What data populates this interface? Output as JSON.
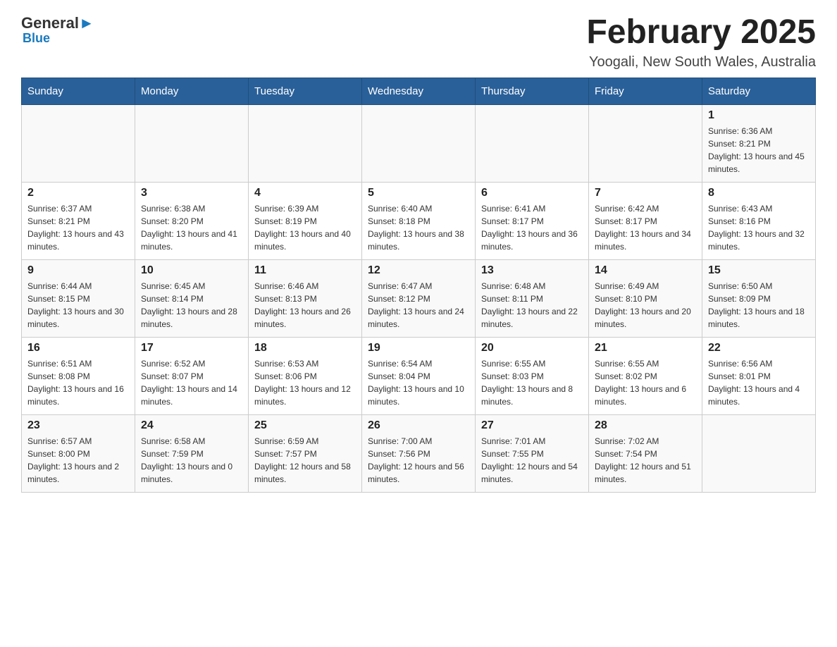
{
  "header": {
    "logo": {
      "general": "General",
      "blue": "Blue",
      "sub": "Blue"
    },
    "title": "February 2025",
    "location": "Yoogali, New South Wales, Australia"
  },
  "weekdays": [
    "Sunday",
    "Monday",
    "Tuesday",
    "Wednesday",
    "Thursday",
    "Friday",
    "Saturday"
  ],
  "weeks": [
    {
      "days": [
        {
          "num": "",
          "info": ""
        },
        {
          "num": "",
          "info": ""
        },
        {
          "num": "",
          "info": ""
        },
        {
          "num": "",
          "info": ""
        },
        {
          "num": "",
          "info": ""
        },
        {
          "num": "",
          "info": ""
        },
        {
          "num": "1",
          "info": "Sunrise: 6:36 AM\nSunset: 8:21 PM\nDaylight: 13 hours and 45 minutes."
        }
      ]
    },
    {
      "days": [
        {
          "num": "2",
          "info": "Sunrise: 6:37 AM\nSunset: 8:21 PM\nDaylight: 13 hours and 43 minutes."
        },
        {
          "num": "3",
          "info": "Sunrise: 6:38 AM\nSunset: 8:20 PM\nDaylight: 13 hours and 41 minutes."
        },
        {
          "num": "4",
          "info": "Sunrise: 6:39 AM\nSunset: 8:19 PM\nDaylight: 13 hours and 40 minutes."
        },
        {
          "num": "5",
          "info": "Sunrise: 6:40 AM\nSunset: 8:18 PM\nDaylight: 13 hours and 38 minutes."
        },
        {
          "num": "6",
          "info": "Sunrise: 6:41 AM\nSunset: 8:17 PM\nDaylight: 13 hours and 36 minutes."
        },
        {
          "num": "7",
          "info": "Sunrise: 6:42 AM\nSunset: 8:17 PM\nDaylight: 13 hours and 34 minutes."
        },
        {
          "num": "8",
          "info": "Sunrise: 6:43 AM\nSunset: 8:16 PM\nDaylight: 13 hours and 32 minutes."
        }
      ]
    },
    {
      "days": [
        {
          "num": "9",
          "info": "Sunrise: 6:44 AM\nSunset: 8:15 PM\nDaylight: 13 hours and 30 minutes."
        },
        {
          "num": "10",
          "info": "Sunrise: 6:45 AM\nSunset: 8:14 PM\nDaylight: 13 hours and 28 minutes."
        },
        {
          "num": "11",
          "info": "Sunrise: 6:46 AM\nSunset: 8:13 PM\nDaylight: 13 hours and 26 minutes."
        },
        {
          "num": "12",
          "info": "Sunrise: 6:47 AM\nSunset: 8:12 PM\nDaylight: 13 hours and 24 minutes."
        },
        {
          "num": "13",
          "info": "Sunrise: 6:48 AM\nSunset: 8:11 PM\nDaylight: 13 hours and 22 minutes."
        },
        {
          "num": "14",
          "info": "Sunrise: 6:49 AM\nSunset: 8:10 PM\nDaylight: 13 hours and 20 minutes."
        },
        {
          "num": "15",
          "info": "Sunrise: 6:50 AM\nSunset: 8:09 PM\nDaylight: 13 hours and 18 minutes."
        }
      ]
    },
    {
      "days": [
        {
          "num": "16",
          "info": "Sunrise: 6:51 AM\nSunset: 8:08 PM\nDaylight: 13 hours and 16 minutes."
        },
        {
          "num": "17",
          "info": "Sunrise: 6:52 AM\nSunset: 8:07 PM\nDaylight: 13 hours and 14 minutes."
        },
        {
          "num": "18",
          "info": "Sunrise: 6:53 AM\nSunset: 8:06 PM\nDaylight: 13 hours and 12 minutes."
        },
        {
          "num": "19",
          "info": "Sunrise: 6:54 AM\nSunset: 8:04 PM\nDaylight: 13 hours and 10 minutes."
        },
        {
          "num": "20",
          "info": "Sunrise: 6:55 AM\nSunset: 8:03 PM\nDaylight: 13 hours and 8 minutes."
        },
        {
          "num": "21",
          "info": "Sunrise: 6:55 AM\nSunset: 8:02 PM\nDaylight: 13 hours and 6 minutes."
        },
        {
          "num": "22",
          "info": "Sunrise: 6:56 AM\nSunset: 8:01 PM\nDaylight: 13 hours and 4 minutes."
        }
      ]
    },
    {
      "days": [
        {
          "num": "23",
          "info": "Sunrise: 6:57 AM\nSunset: 8:00 PM\nDaylight: 13 hours and 2 minutes."
        },
        {
          "num": "24",
          "info": "Sunrise: 6:58 AM\nSunset: 7:59 PM\nDaylight: 13 hours and 0 minutes."
        },
        {
          "num": "25",
          "info": "Sunrise: 6:59 AM\nSunset: 7:57 PM\nDaylight: 12 hours and 58 minutes."
        },
        {
          "num": "26",
          "info": "Sunrise: 7:00 AM\nSunset: 7:56 PM\nDaylight: 12 hours and 56 minutes."
        },
        {
          "num": "27",
          "info": "Sunrise: 7:01 AM\nSunset: 7:55 PM\nDaylight: 12 hours and 54 minutes."
        },
        {
          "num": "28",
          "info": "Sunrise: 7:02 AM\nSunset: 7:54 PM\nDaylight: 12 hours and 51 minutes."
        },
        {
          "num": "",
          "info": ""
        }
      ]
    }
  ]
}
